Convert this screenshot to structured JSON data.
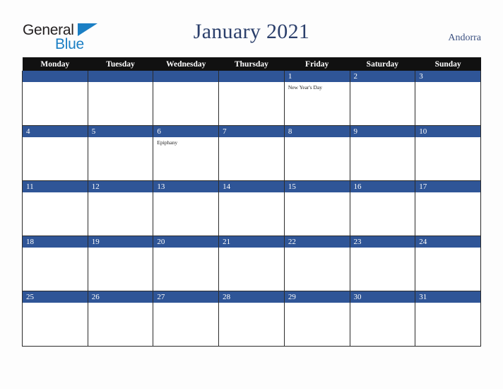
{
  "brand": {
    "name_part1": "General",
    "name_part2": "Blue",
    "triangle_icon": "triangle-icon",
    "accent_color": "#1b7fc4",
    "text_color": "#231f20"
  },
  "header": {
    "title": "January 2021",
    "country": "Andorra",
    "title_color": "#2b3f6b",
    "country_color": "#3b5080"
  },
  "calendar": {
    "weekday_headers": [
      "Monday",
      "Tuesday",
      "Wednesday",
      "Thursday",
      "Friday",
      "Saturday",
      "Sunday"
    ],
    "header_bg": "#111111",
    "header_text_color": "#ffffff",
    "date_bar_color": "#2f5597",
    "date_text_color": "#ffffff",
    "cell_bg": "#ffffff",
    "border_color": "#2b2b2b",
    "weeks": [
      [
        {
          "num": "",
          "events": []
        },
        {
          "num": "",
          "events": []
        },
        {
          "num": "",
          "events": []
        },
        {
          "num": "",
          "events": []
        },
        {
          "num": "1",
          "events": [
            "New Year's Day"
          ]
        },
        {
          "num": "2",
          "events": []
        },
        {
          "num": "3",
          "events": []
        }
      ],
      [
        {
          "num": "4",
          "events": []
        },
        {
          "num": "5",
          "events": []
        },
        {
          "num": "6",
          "events": [
            "Epiphany"
          ]
        },
        {
          "num": "7",
          "events": []
        },
        {
          "num": "8",
          "events": []
        },
        {
          "num": "9",
          "events": []
        },
        {
          "num": "10",
          "events": []
        }
      ],
      [
        {
          "num": "11",
          "events": []
        },
        {
          "num": "12",
          "events": []
        },
        {
          "num": "13",
          "events": []
        },
        {
          "num": "14",
          "events": []
        },
        {
          "num": "15",
          "events": []
        },
        {
          "num": "16",
          "events": []
        },
        {
          "num": "17",
          "events": []
        }
      ],
      [
        {
          "num": "18",
          "events": []
        },
        {
          "num": "19",
          "events": []
        },
        {
          "num": "20",
          "events": []
        },
        {
          "num": "21",
          "events": []
        },
        {
          "num": "22",
          "events": []
        },
        {
          "num": "23",
          "events": []
        },
        {
          "num": "24",
          "events": []
        }
      ],
      [
        {
          "num": "25",
          "events": []
        },
        {
          "num": "26",
          "events": []
        },
        {
          "num": "27",
          "events": []
        },
        {
          "num": "28",
          "events": []
        },
        {
          "num": "29",
          "events": []
        },
        {
          "num": "30",
          "events": []
        },
        {
          "num": "31",
          "events": []
        }
      ]
    ]
  }
}
